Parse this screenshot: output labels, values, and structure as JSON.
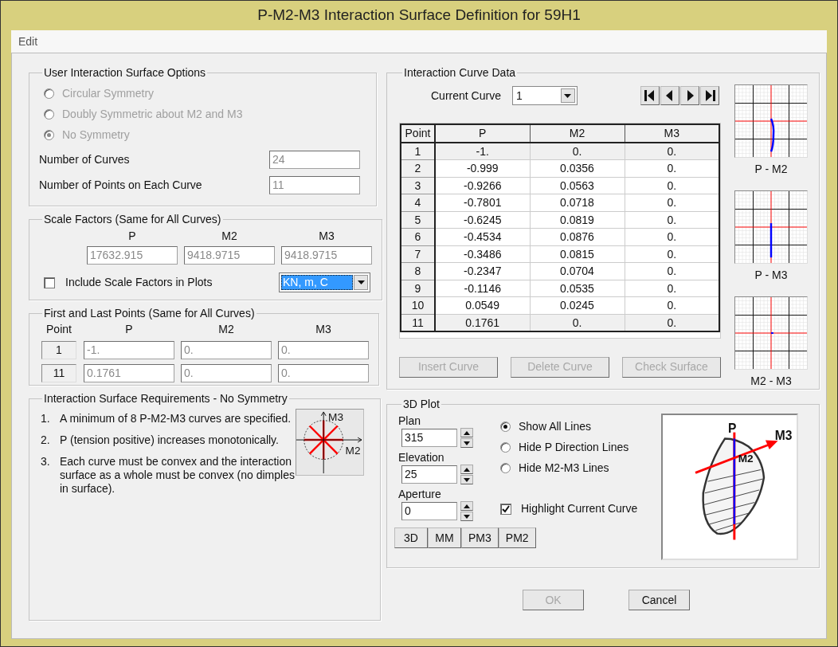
{
  "window": {
    "title": "P-M2-M3 Interaction Surface Definition for 59H1"
  },
  "menu": [
    {
      "label": "Edit"
    }
  ],
  "surface_options": {
    "title": "User Interaction Surface Options",
    "radios": [
      {
        "label": "Circular Symmetry",
        "selected": false,
        "disabled": true
      },
      {
        "label": "Doubly Symmetric about M2 and M3",
        "selected": false,
        "disabled": true
      },
      {
        "label": "No Symmetry",
        "selected": true,
        "disabled": true
      }
    ],
    "fields": [
      {
        "label": "Number of Curves",
        "value": "24",
        "disabled": true
      },
      {
        "label": "Number of Points on Each Curve",
        "value": "11",
        "disabled": true
      }
    ]
  },
  "scale_factors": {
    "title": "Scale Factors (Same for All Curves)",
    "columns": [
      "P",
      "M2",
      "M3"
    ],
    "values": [
      "17632.915",
      "9418.9715",
      "9418.9715"
    ],
    "disabled": true,
    "include_in_plots": {
      "label": "Include Scale Factors in Plots",
      "checked": false
    },
    "units": {
      "value": "KN, m, C",
      "highlighted": true
    }
  },
  "first_last": {
    "title": "First and Last Points (Same for All Curves)",
    "columns": [
      "Point",
      "P",
      "M2",
      "M3"
    ],
    "disabled": true,
    "rows": [
      {
        "point": "1",
        "values": [
          "-1.",
          "0.",
          "0."
        ]
      },
      {
        "point": "11",
        "values": [
          "0.1761",
          "0.",
          "0."
        ]
      }
    ]
  },
  "requirements": {
    "title": "Interaction Surface Requirements - No Symmetry",
    "items": [
      {
        "number": "1.",
        "text": "A minimum of 8 P-M2-M3 curves are specified."
      },
      {
        "number": "2.",
        "text": "P (tension positive) increases monotonically."
      },
      {
        "number": "3.",
        "text": "Each curve must be convex and the interaction surface as a whole must be convex (no dimples in surface)."
      }
    ],
    "diagram_labels": {
      "vertical": "M3",
      "horizontal": "M2"
    }
  },
  "curve_data": {
    "title": "Interaction Curve Data",
    "current_curve": {
      "label": "Current Curve",
      "value": "1"
    },
    "table": {
      "columns": [
        "Point",
        "P",
        "M2",
        "M3"
      ],
      "rows": [
        {
          "cells": [
            "1",
            "-1.",
            "0.",
            "0."
          ],
          "shaded": true
        },
        {
          "cells": [
            "2",
            "-0.999",
            "0.0356",
            "0."
          ],
          "shaded": false
        },
        {
          "cells": [
            "3",
            "-0.9266",
            "0.0563",
            "0."
          ],
          "shaded": false
        },
        {
          "cells": [
            "4",
            "-0.7801",
            "0.0718",
            "0."
          ],
          "shaded": false
        },
        {
          "cells": [
            "5",
            "-0.6245",
            "0.0819",
            "0."
          ],
          "shaded": false
        },
        {
          "cells": [
            "6",
            "-0.4534",
            "0.0876",
            "0."
          ],
          "shaded": false
        },
        {
          "cells": [
            "7",
            "-0.3486",
            "0.0815",
            "0."
          ],
          "shaded": false
        },
        {
          "cells": [
            "8",
            "-0.2347",
            "0.0704",
            "0."
          ],
          "shaded": false
        },
        {
          "cells": [
            "9",
            "-0.1146",
            "0.0535",
            "0."
          ],
          "shaded": false
        },
        {
          "cells": [
            "10",
            "0.0549",
            "0.0245",
            "0."
          ],
          "shaded": false
        },
        {
          "cells": [
            "11",
            "0.1761",
            "0.",
            "0."
          ],
          "shaded": true
        }
      ]
    },
    "buttons": [
      {
        "label": "Insert Curve",
        "disabled": true
      },
      {
        "label": "Delete Curve",
        "disabled": true
      },
      {
        "label": "Check Surface",
        "disabled": true
      }
    ],
    "thumbnails": [
      {
        "label": "P - M2",
        "kind": "pm2"
      },
      {
        "label": "P - M3",
        "kind": "pm3"
      },
      {
        "label": "M2 - M3",
        "kind": "m2m3"
      }
    ]
  },
  "plot3d": {
    "title": "3D Plot",
    "spinners": [
      {
        "label": "Plan",
        "value": "315"
      },
      {
        "label": "Elevation",
        "value": "25"
      },
      {
        "label": "Aperture",
        "value": "0"
      }
    ],
    "radios": [
      {
        "label": "Show All Lines",
        "selected": true
      },
      {
        "label": "Hide P Direction Lines",
        "selected": false
      },
      {
        "label": "Hide M2-M3 Lines",
        "selected": false
      }
    ],
    "highlight": {
      "label": "Highlight Current Curve",
      "checked": true
    },
    "view_buttons": [
      "3D",
      "MM",
      "PM3",
      "PM2"
    ],
    "axis_labels": {
      "p": "P",
      "m3": "M3",
      "m2": "M2"
    }
  },
  "buttons": [
    {
      "label": "OK",
      "disabled": true
    },
    {
      "label": "Cancel",
      "disabled": false
    }
  ]
}
